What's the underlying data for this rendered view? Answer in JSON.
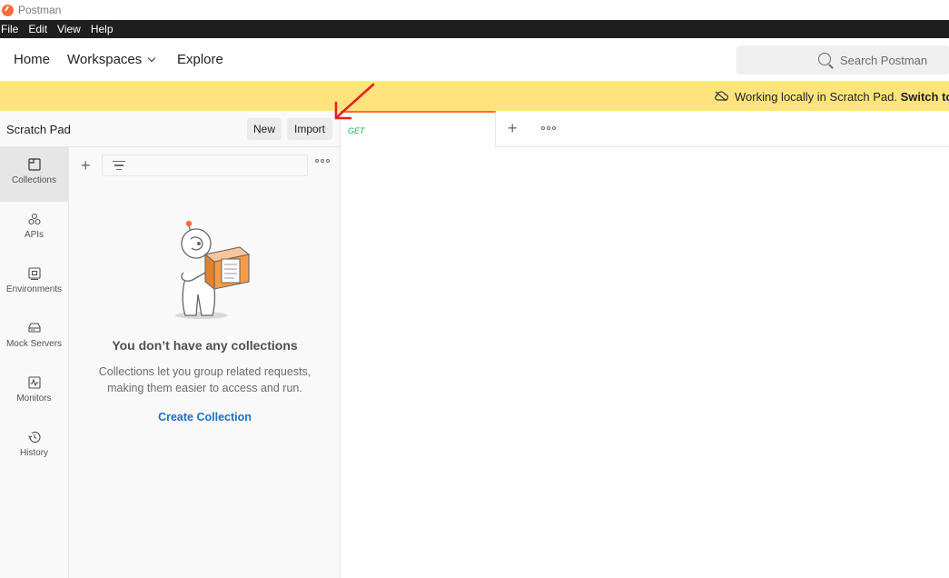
{
  "window": {
    "title": "Postman"
  },
  "menu": [
    "File",
    "Edit",
    "View",
    "Help"
  ],
  "nav": {
    "home": "Home",
    "workspaces": "Workspaces",
    "explore": "Explore"
  },
  "search": {
    "placeholder": "Search Postman"
  },
  "banner": {
    "text": "Working locally in Scratch Pad.",
    "link": "Switch to"
  },
  "sidebar": {
    "title": "Scratch Pad",
    "new_label": "New",
    "import_label": "Import",
    "items": [
      {
        "label": "Collections",
        "icon": "collections-icon",
        "active": true
      },
      {
        "label": "APIs",
        "icon": "apis-icon"
      },
      {
        "label": "Environments",
        "icon": "environments-icon"
      },
      {
        "label": "Mock Servers",
        "icon": "mock-servers-icon"
      },
      {
        "label": "Monitors",
        "icon": "monitors-icon"
      },
      {
        "label": "History",
        "icon": "history-icon"
      }
    ]
  },
  "collections": {
    "empty_title": "You don’t have any collections",
    "empty_desc": "Collections let you group related requests, making them easier to access and run.",
    "create_label": "Create Collection"
  },
  "tabs": [
    {
      "method": "GET"
    }
  ],
  "colors": {
    "accent": "#ff6c37",
    "banner": "#ffe47e",
    "link": "#1f6fc5",
    "get": "#0cbb52",
    "annotation": "#e8211d"
  }
}
